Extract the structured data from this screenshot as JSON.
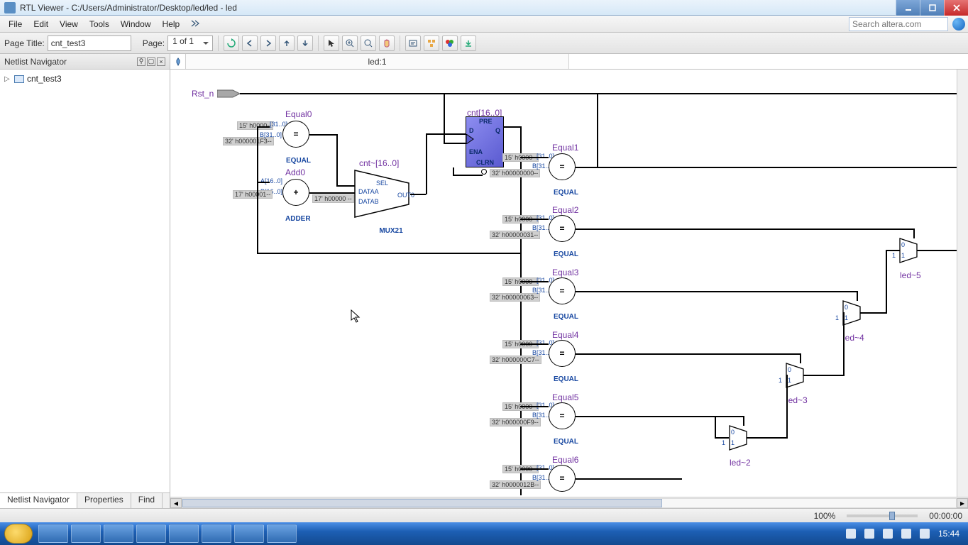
{
  "window": {
    "title": "RTL Viewer - C:/Users/Administrator/Desktop/led/led - led"
  },
  "menu": {
    "file": "File",
    "edit": "Edit",
    "view": "View",
    "tools": "Tools",
    "window": "Window",
    "help": "Help"
  },
  "search": {
    "placeholder": "Search altera.com"
  },
  "toolbar": {
    "page_title_label": "Page Title:",
    "page_title_value": "cnt_test3",
    "page_label": "Page:",
    "page_value": "1 of 1"
  },
  "sidebar": {
    "header": "Netlist Navigator",
    "root": "cnt_test3"
  },
  "side_tabs": {
    "netlist": "Netlist Navigator",
    "properties": "Properties",
    "find": "Find"
  },
  "doc_tab": "led:1",
  "status": {
    "zoom": "100%",
    "time": "00:00:00"
  },
  "tray": {
    "clock": "15:44"
  },
  "schematic": {
    "rst": "Rst_n",
    "equal0": "Equal0",
    "add0": "Add0",
    "cnt_mux": "cnt~[16..0]",
    "cnt_reg": "cnt[16..0]",
    "equal1": "Equal1",
    "equal2": "Equal2",
    "equal3": "Equal3",
    "equal4": "Equal4",
    "equal5": "Equal5",
    "equal6": "Equal6",
    "led2": "led~2",
    "led3": "led~3",
    "led4": "led~4",
    "led5": "led~5",
    "type_equal": "EQUAL",
    "type_adder": "ADDER",
    "type_mux": "MUX21",
    "op_eq": "=",
    "op_add": "+",
    "reg_pre": "PRE",
    "reg_d": "D",
    "reg_q": "Q",
    "reg_ena": "ENA",
    "reg_clrn": "CLRN",
    "mux_sel": "SEL",
    "mux_dataa": "DATAA",
    "mux_datab": "DATAB",
    "mux_out": "OUT0",
    "port_a": "A[16..0]",
    "port_b16": "B[16..0]",
    "port_b31": "B[31..0]",
    "port_31": "[31..0]",
    "c_15h0": "15' h0000--",
    "c_32h1f3": "32' h000001F3--",
    "c_17h1": "17' h00001--",
    "c_17h0": "17' h00000 --",
    "c_32h0": "32' h00000000--",
    "c_32h31": "32' h00000031--",
    "c_32h63": "32' h00000063--",
    "c_32hc7": "32' h000000C7--",
    "c_32hf9": "32' h000000F9--",
    "c_32h12b": "32' h0000012B--",
    "mm_0": "0",
    "mm_1": "1"
  }
}
